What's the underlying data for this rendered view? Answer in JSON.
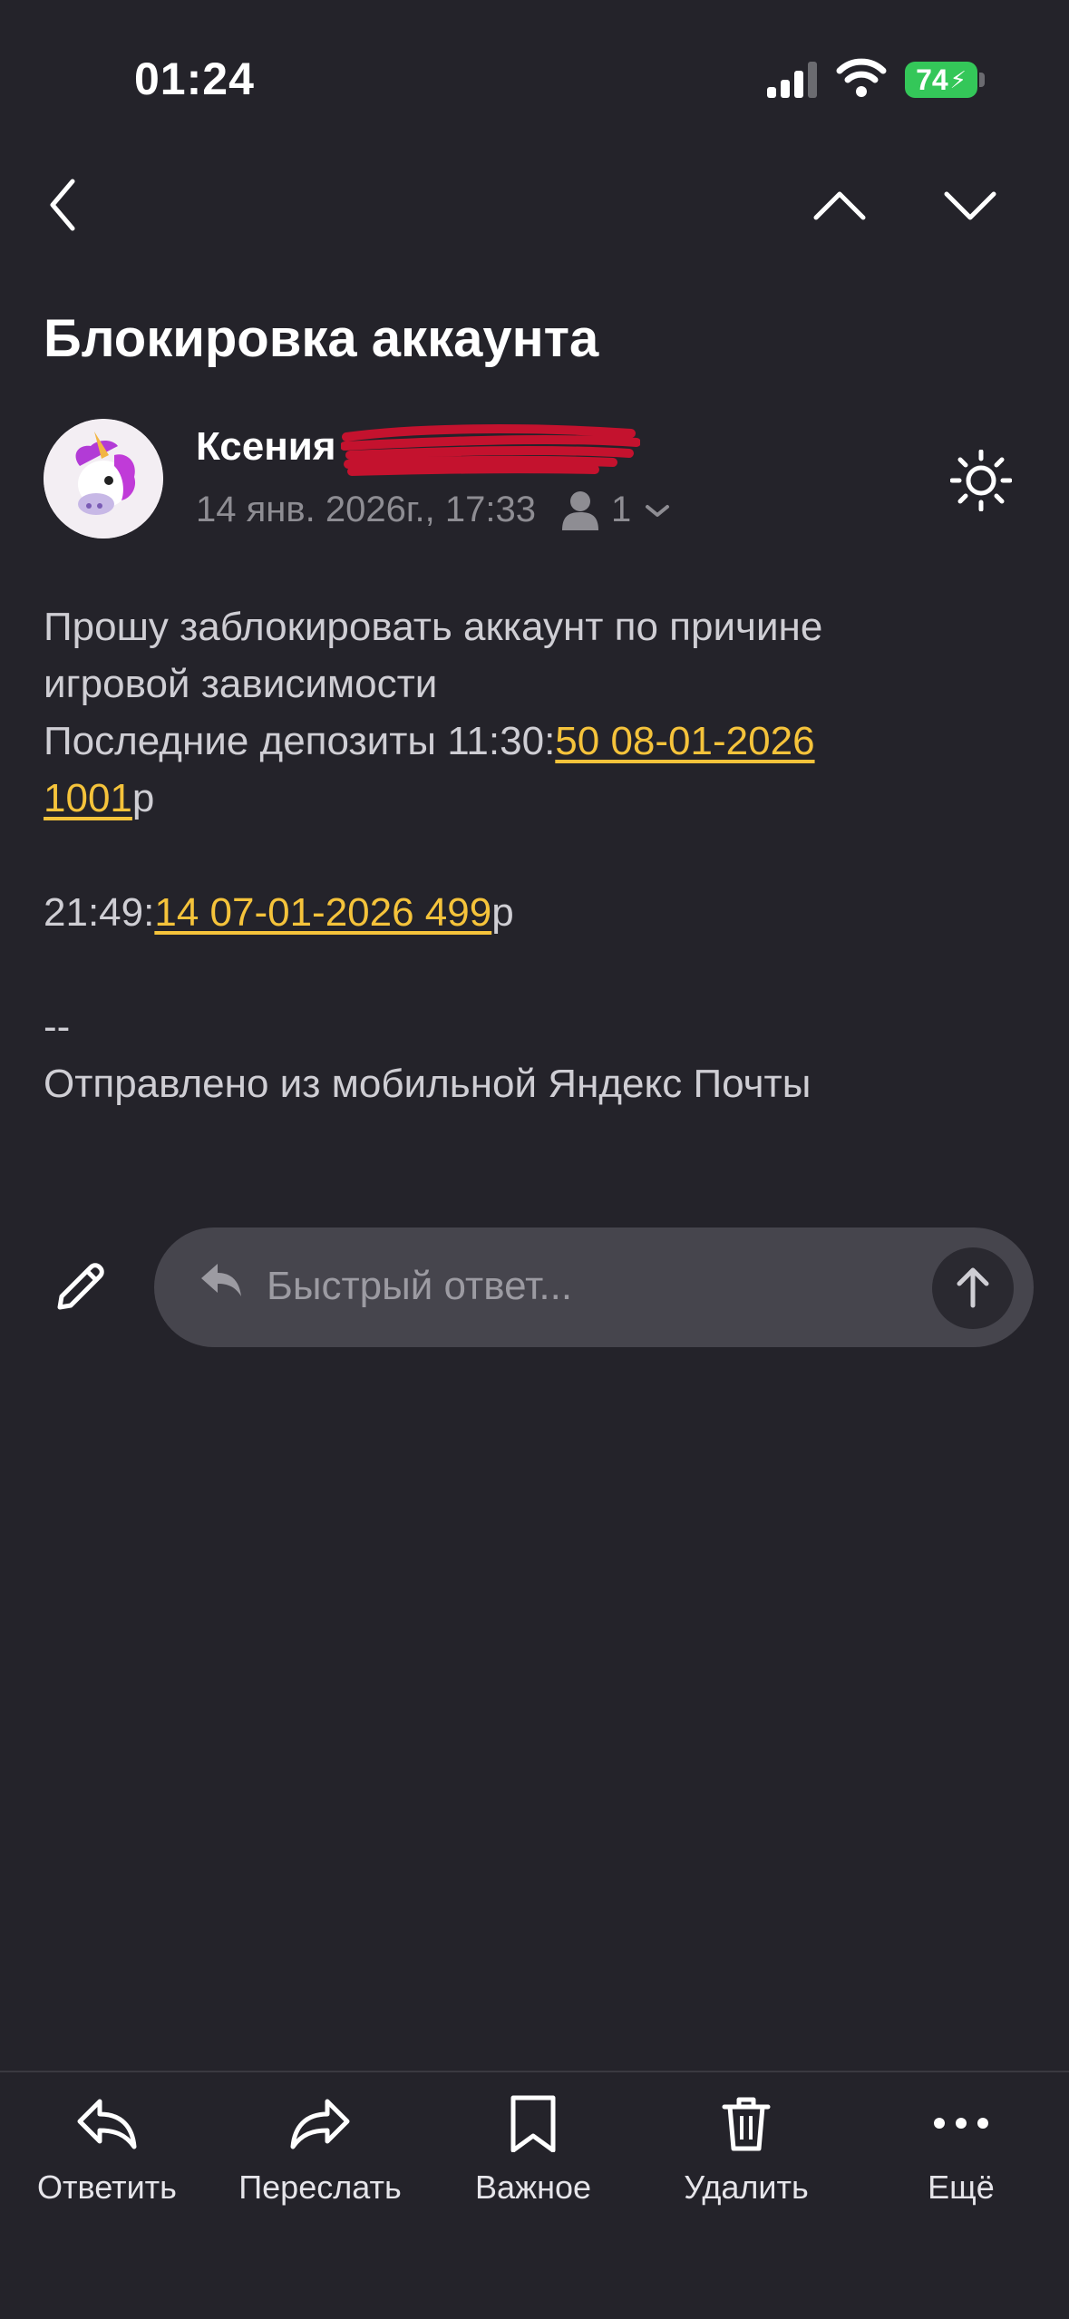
{
  "status_bar": {
    "time": "01:24",
    "battery": "74"
  },
  "email": {
    "subject": "Блокировка аккаунта",
    "sender_name": "Ксения",
    "date": "14 янв. 2026г., 17:33",
    "recipients_count": "1",
    "body": {
      "line1": "Прошу заблокировать аккаунт по причине",
      "line2": "игровой зависимости",
      "line3_prefix": "Последние депозиты 11:30:",
      "line3_link": "50 08-01-2026",
      "line4_link": "1001",
      "line4_suffix": "р",
      "line5_prefix": "21:49:",
      "line5_link": "14 07-01-2026 499",
      "line5_suffix": "р",
      "signature_sep": "--",
      "signature": "Отправлено из мобильной Яндекс Почты"
    }
  },
  "quick_reply": {
    "placeholder": "Быстрый ответ..."
  },
  "toolbar": {
    "reply": "Ответить",
    "forward": "Переслать",
    "important": "Важное",
    "delete": "Удалить",
    "more": "Ещё"
  },
  "colors": {
    "background": "#24232a",
    "link": "#f5c33b",
    "battery": "#34c759",
    "redaction": "#c4122e"
  }
}
